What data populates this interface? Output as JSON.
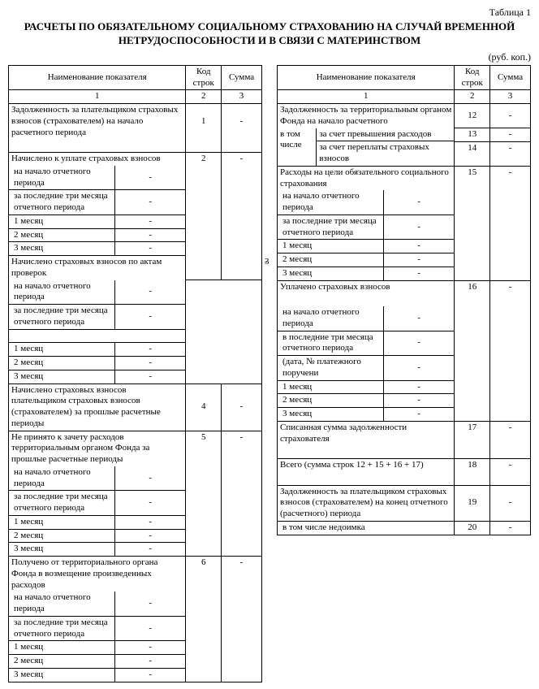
{
  "tableLabel": "Таблица 1",
  "title1": "РАСЧЕТЫ ПО ОБЯЗАТЕЛЬНОМУ СОЦИАЛЬНОМУ СТРАХОВАНИЮ НА СЛУЧАЙ ВРЕМЕННОЙ",
  "title2": "НЕТРУДОСПОСОБНОСТИ И В СВЯЗИ С МАТЕРИНСТВОМ",
  "units": "(руб. коп.)",
  "head": {
    "name": "Наименование показателя",
    "code": "Код строк",
    "sum": "Сумма",
    "n1": "1",
    "n2": "2",
    "n3": "3"
  },
  "sub": {
    "begin": "на начало отчетного периода",
    "last3": "за последние три месяца отчетного периода",
    "in3": "в последние три месяца отчетного периода",
    "m1": "1 месяц",
    "m2": "2 месяц",
    "m3": "3 месяц",
    "dateNo": "(дата, № платежного поручени",
    "vtom": "в том числе",
    "overExp": "за счет превышения расходов",
    "overPay": "за счет переплаты страховых взносов"
  },
  "left": {
    "r1": {
      "name": "Задолженность за плательщиком страховых взносов (страхователем) на начало расчетного периода",
      "code": "1",
      "sum": "-"
    },
    "r2": {
      "name": "Начислено к уплате страховых взносов",
      "code": "2",
      "sum": "-",
      "begin": "-",
      "last3": "-",
      "m1": "-",
      "m2": "-",
      "m3": "-"
    },
    "r3": {
      "name": "Начислено страховых взносов по актам проверок",
      "code": "3",
      "sum": "-",
      "begin": "-",
      "last3": "-",
      "m1": "-",
      "m2": "-",
      "m3": "-"
    },
    "r4": {
      "name": "Начислено страховых взносов плательщиком страховых взносов (страхователем) за прошлые расчетные периоды",
      "code": "4",
      "sum": "-"
    },
    "r5": {
      "name": "Не принято к зачету расходов территориальным органом Фонда за прошлые расчетные периоды",
      "code": "5",
      "sum": "-",
      "begin": "-",
      "last3": "-",
      "m1": "-",
      "m2": "-",
      "m3": "-"
    },
    "r6": {
      "name": "Получено от территориального органа Фонда в возмещение произведенных расходов",
      "code": "6",
      "sum": "-",
      "begin": "-",
      "last3": "-",
      "m1": "-",
      "m2": "-",
      "m3": "-"
    }
  },
  "right": {
    "r12": {
      "name": "Задолженность за территориальным органом Фонда на начало расчетного",
      "code": "12",
      "sum": "-"
    },
    "r13": {
      "code": "13",
      "sum": "-"
    },
    "r14": {
      "code": "14",
      "sum": "-"
    },
    "r15": {
      "name": "Расходы на цели обязательного социального страхования",
      "code": "15",
      "sum": "-",
      "begin": "-",
      "last3": "-",
      "m1": "-",
      "m2": "-",
      "m3": "-"
    },
    "r16": {
      "name": "Уплачено страховых взносов",
      "code": "16",
      "sum": "-",
      "begin": "-",
      "in3": "-",
      "dateNo": "-",
      "m1": "-",
      "m2": "-",
      "m3": "-"
    },
    "r17": {
      "name": "Списанная сумма задолженности страхователя",
      "code": "17",
      "sum": "-"
    },
    "r18": {
      "name": "Всего (сумма строк 12 + 15 + 16 + 17)",
      "code": "18",
      "sum": "-"
    },
    "r19": {
      "name": "Задолженность за плательщиком страховых взносов (страхователем) на конец отчетного (расчетного) периода",
      "code": "19",
      "sum": "-"
    },
    "r20": {
      "name": "в том числе недоимка",
      "code": "20",
      "sum": "-"
    }
  }
}
